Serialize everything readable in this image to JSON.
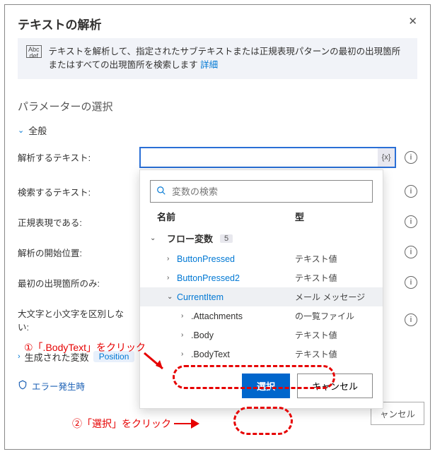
{
  "dialog": {
    "title": "テキストの解析",
    "banner_icon": "Abc\ndef",
    "banner_text": "テキストを解析して、指定されたサブテキストまたは正規表現パターンの最初の出現箇所またはすべての出現箇所を検索します ",
    "banner_link": "詳細",
    "section": "パラメーターの選択",
    "group": "全般",
    "fields": {
      "text_to_parse": "解析するテキスト:",
      "text_to_find": "検索するテキスト:",
      "is_regex": "正規表現である:",
      "start_pos": "解析の開始位置:",
      "first_only": "最初の出現箇所のみ:",
      "ignore_case": "大文字と小文字を区別しない:"
    },
    "gen_var_label": "生成された変数",
    "gen_var_pill": "Position",
    "error_label": "エラー発生時",
    "fx": "{x}",
    "bg_cancel": "ャンセル"
  },
  "search": {
    "placeholder": "変数の検索"
  },
  "columns": {
    "name": "名前",
    "type": "型"
  },
  "group_header": {
    "label": "フロー変数",
    "count": "5"
  },
  "items": [
    {
      "name": "ButtonPressed",
      "type": "テキスト値",
      "link": true,
      "chev": ">"
    },
    {
      "name": "ButtonPressed2",
      "type": "テキスト値",
      "link": true,
      "chev": ">"
    },
    {
      "name": "CurrentItem",
      "type": "メール メッセージ",
      "link": true,
      "chev": "v",
      "hi": true
    },
    {
      "name": ".Attachments",
      "type": "の一覧ファイル",
      "link": false,
      "chev": ">"
    },
    {
      "name": ".Body",
      "type": "テキスト値",
      "link": false,
      "chev": ">"
    },
    {
      "name": ".BodyText",
      "type": "テキスト値",
      "link": false,
      "chev": ">"
    }
  ],
  "buttons": {
    "select": "選択",
    "cancel": "キャンセル"
  },
  "callouts": {
    "c1": "①「.BodyText」をクリック",
    "c2": "②「選択」をクリック"
  }
}
